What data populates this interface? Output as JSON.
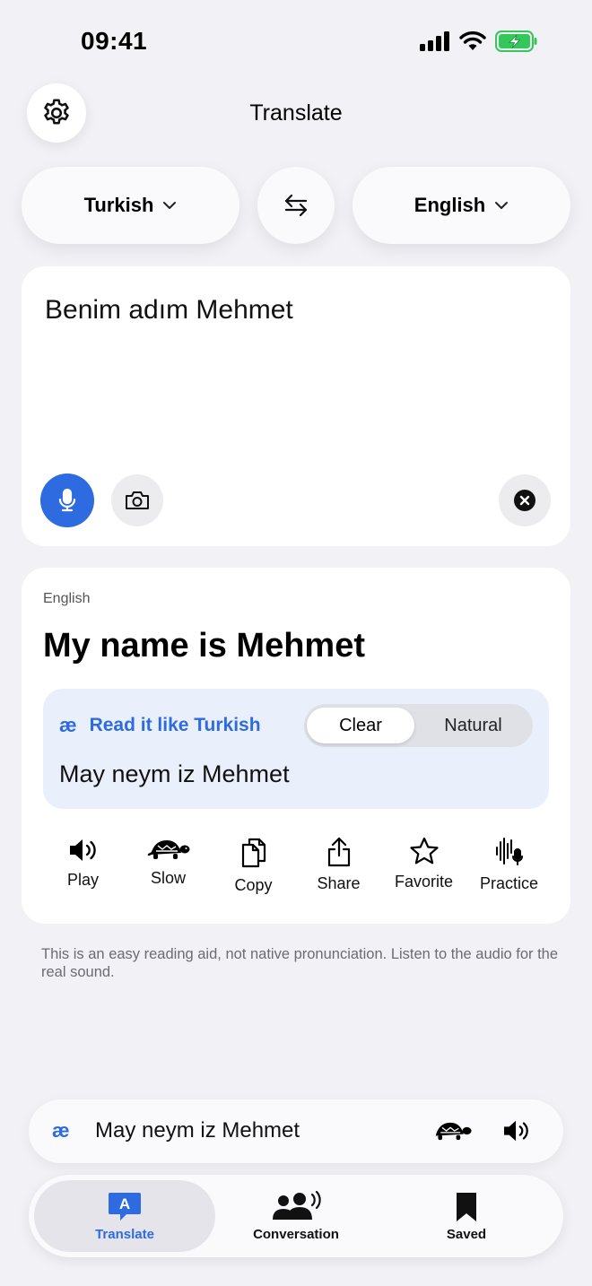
{
  "status_bar": {
    "time": "09:41"
  },
  "header": {
    "title": "Translate",
    "settings_icon": "gear-icon"
  },
  "languages": {
    "source": "Turkish",
    "target": "English",
    "swap_icon": "swap-arrows-icon"
  },
  "input": {
    "text": "Benim adım Mehmet"
  },
  "output": {
    "language": "English",
    "text": "My name is Mehmet",
    "read_it_like_label": "Read it like Turkish",
    "mode_options": [
      "Clear",
      "Natural"
    ],
    "selected_mode": "Clear",
    "phonetic_text": "May neym iz Mehmet"
  },
  "actions": {
    "play": "Play",
    "slow": "Slow",
    "copy": "Copy",
    "share": "Share",
    "favorite": "Favorite",
    "practice": "Practice"
  },
  "note": "This is an easy reading aid, not native pronunciation. Listen to the audio for the real sound.",
  "pronunciation_bar": {
    "text": "May neym iz Mehmet"
  },
  "tabs": {
    "translate": "Translate",
    "conversation": "Conversation",
    "saved": "Saved",
    "active": "Translate"
  },
  "colors": {
    "accent": "#2e6be0",
    "background": "#f1f1f6",
    "battery": "#34c759"
  },
  "glyphs": {
    "ae": "æ",
    "translate_tab_letter": "A"
  }
}
